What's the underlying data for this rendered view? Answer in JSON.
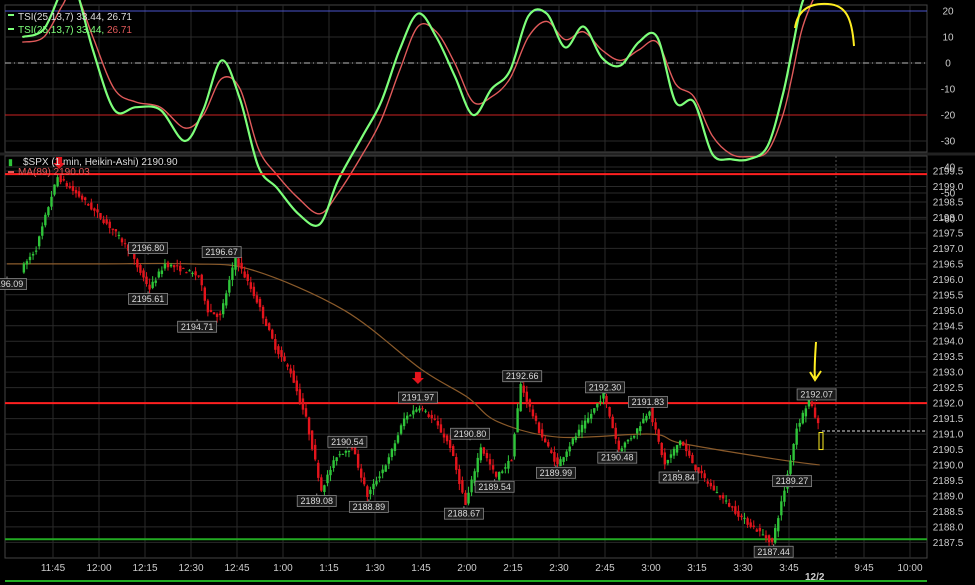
{
  "colors": {
    "up": "#2fc43a",
    "down": "#e3141c",
    "tsi": "#7dff7a",
    "signal": "#e05a5a",
    "ma": "#8a5a2a",
    "resistance": "#ff2020",
    "support": "#22aa22",
    "grid": "#2a2a2a",
    "annotation": "#ffee22"
  },
  "tsi_panel": {
    "legend_a": "TSI(25,13,7) 33.44, 26.71",
    "legend_b_prefix": "TSI(25,13,7) 33.44, ",
    "legend_b_suffix": "26.71",
    "y_ticks": [
      "30",
      "20",
      "10",
      "0",
      "-10",
      "-20",
      "-30",
      "-40",
      "-50",
      "-60"
    ]
  },
  "price_panel": {
    "legend_symbol": "$SPX (1 min, Heikin-Ashi) 2190.90",
    "legend_ma": "MA(89) 2190.03",
    "y_ticks": [
      "2199.5",
      "2199.0",
      "2198.5",
      "2198.0",
      "2197.5",
      "2197.0",
      "2196.5",
      "2196.0",
      "2195.5",
      "2195.0",
      "2194.5",
      "2194.0",
      "2193.5",
      "2193.0",
      "2192.5",
      "2192.0",
      "2191.5",
      "2191.0",
      "2190.5",
      "2190.0",
      "2189.5",
      "2189.0",
      "2188.5",
      "2188.0",
      "2187.5"
    ],
    "date_label": "12/2"
  },
  "chart_data": [
    {
      "type": "line",
      "title": "TSI(25,13,7) 33.44, 26.71",
      "ylim": [
        -65,
        38
      ],
      "reference_lines": [
        20,
        0,
        -20
      ],
      "series": [
        {
          "name": "TSI(25,13,7)",
          "x": [
            "11:35",
            "11:42",
            "11:48",
            "11:52",
            "11:58",
            "12:05",
            "12:12",
            "12:20",
            "12:28",
            "12:34",
            "12:40",
            "12:46",
            "12:52",
            "12:58",
            "13:05",
            "13:12",
            "13:18",
            "13:26",
            "13:32",
            "13:38",
            "13:44",
            "13:50",
            "13:56",
            "14:02",
            "14:08",
            "14:14",
            "14:20",
            "14:26",
            "14:32",
            "14:38",
            "14:44",
            "14:50",
            "14:56",
            "15:02",
            "15:08",
            "15:14",
            "15:20",
            "15:26",
            "15:32",
            "15:38",
            "15:43",
            "15:46",
            "15:49",
            "15:52",
            "15:54"
          ],
          "values": [
            10,
            13,
            28,
            30,
            5,
            -18,
            -17,
            -18,
            -30,
            -18,
            1,
            -14,
            -40,
            -48,
            -58,
            -62,
            -45,
            -28,
            -15,
            5,
            19,
            10,
            -5,
            -20,
            -10,
            -3,
            18,
            19,
            6,
            14,
            2,
            -1,
            8,
            10,
            -15,
            -15,
            -35,
            -37,
            -37,
            -32,
            -12,
            5,
            22,
            30,
            32
          ]
        },
        {
          "name": "signal",
          "x": [
            "11:35",
            "11:42",
            "11:48",
            "11:52",
            "11:58",
            "12:05",
            "12:12",
            "12:20",
            "12:28",
            "12:34",
            "12:40",
            "12:46",
            "12:52",
            "12:58",
            "13:05",
            "13:12",
            "13:18",
            "13:26",
            "13:32",
            "13:38",
            "13:44",
            "13:50",
            "13:56",
            "14:02",
            "14:08",
            "14:14",
            "14:20",
            "14:26",
            "14:32",
            "14:38",
            "14:44",
            "14:50",
            "14:56",
            "15:02",
            "15:08",
            "15:14",
            "15:20",
            "15:26",
            "15:32",
            "15:38",
            "15:43",
            "15:46",
            "15:49",
            "15:52",
            "15:54"
          ],
          "values": [
            8,
            10,
            22,
            28,
            10,
            -10,
            -15,
            -17,
            -25,
            -20,
            -6,
            -10,
            -33,
            -43,
            -52,
            -58,
            -50,
            -35,
            -22,
            -3,
            14,
            12,
            0,
            -15,
            -13,
            -6,
            10,
            16,
            9,
            12,
            5,
            1,
            5,
            8,
            -8,
            -13,
            -28,
            -35,
            -36,
            -34,
            -20,
            -5,
            12,
            22,
            27
          ]
        }
      ]
    },
    {
      "type": "candlestick",
      "title": "$SPX (1 min, Heikin-Ashi) 2190.90",
      "ylim": [
        2187.25,
        2199.75
      ],
      "x_ticks": [
        "11:45",
        "12:00",
        "12:15",
        "12:30",
        "12:45",
        "1:00",
        "1:15",
        "1:30",
        "1:45",
        "2:00",
        "2:15",
        "2:30",
        "2:45",
        "3:00",
        "3:15",
        "3:30",
        "3:45",
        "9:45",
        "10:00"
      ],
      "path": [
        [
          "11:35",
          2196.3
        ],
        [
          "11:40",
          2197.0
        ],
        [
          "11:45",
          2198.7
        ],
        [
          "11:47",
          2199.3
        ],
        [
          "11:55",
          2198.6
        ],
        [
          "12:05",
          2197.6
        ],
        [
          "12:10",
          2197.0
        ],
        [
          "12:13",
          2196.4
        ],
        [
          "12:17",
          2195.7
        ],
        [
          "12:22",
          2196.5
        ],
        [
          "12:28",
          2196.3
        ],
        [
          "12:33",
          2196.1
        ],
        [
          "12:36",
          2195.0
        ],
        [
          "12:40",
          2194.8
        ],
        [
          "12:45",
          2196.7
        ],
        [
          "12:52",
          2195.3
        ],
        [
          "12:58",
          2193.8
        ],
        [
          "13:03",
          2193.0
        ],
        [
          "13:08",
          2191.5
        ],
        [
          "13:13",
          2189.2
        ],
        [
          "13:18",
          2190.3
        ],
        [
          "13:23",
          2190.6
        ],
        [
          "13:28",
          2189.0
        ],
        [
          "13:35",
          2190.2
        ],
        [
          "13:40",
          2191.5
        ],
        [
          "13:45",
          2191.9
        ],
        [
          "13:50",
          2191.4
        ],
        [
          "13:55",
          2190.6
        ],
        [
          "14:00",
          2188.7
        ],
        [
          "14:05",
          2190.6
        ],
        [
          "14:10",
          2189.6
        ],
        [
          "14:15",
          2190.2
        ],
        [
          "14:18",
          2192.6
        ],
        [
          "14:24",
          2191.1
        ],
        [
          "14:30",
          2190.0
        ],
        [
          "14:35",
          2190.8
        ],
        [
          "14:40",
          2191.5
        ],
        [
          "14:45",
          2192.3
        ],
        [
          "14:50",
          2190.5
        ],
        [
          "14:55",
          2191.0
        ],
        [
          "15:00",
          2191.8
        ],
        [
          "15:05",
          2190.0
        ],
        [
          "15:10",
          2190.8
        ],
        [
          "15:15",
          2189.9
        ],
        [
          "15:20",
          2189.3
        ],
        [
          "15:25",
          2188.8
        ],
        [
          "15:30",
          2188.3
        ],
        [
          "15:35",
          2187.9
        ],
        [
          "15:40",
          2187.5
        ],
        [
          "15:44",
          2189.2
        ],
        [
          "15:48",
          2191.2
        ],
        [
          "15:52",
          2192.1
        ],
        [
          "15:55",
          2191.3
        ]
      ],
      "ma89": [
        [
          "11:30",
          2196.5
        ],
        [
          "12:00",
          2196.5
        ],
        [
          "12:30",
          2196.5
        ],
        [
          "12:50",
          2196.3
        ],
        [
          "13:20",
          2195.0
        ],
        [
          "13:45",
          2193.1
        ],
        [
          "14:00",
          2192.2
        ],
        [
          "14:10",
          2191.4
        ],
        [
          "14:30",
          2190.9
        ],
        [
          "15:00",
          2191.0
        ],
        [
          "15:10",
          2190.7
        ],
        [
          "15:40",
          2190.2
        ],
        [
          "15:55",
          2190.0
        ]
      ],
      "horizontal_lines": [
        {
          "kind": "resistance",
          "value": 2199.4
        },
        {
          "kind": "resistance",
          "value": 2192.0
        },
        {
          "kind": "support",
          "value": 2187.6
        },
        {
          "kind": "current",
          "value": 2191.1
        }
      ],
      "annotations": [
        {
          "label": "2196.09",
          "x": "11:30",
          "y": 2196.09,
          "pos": "below"
        },
        {
          "label": "2196.80",
          "x": "12:16",
          "y": 2196.8,
          "pos": "above"
        },
        {
          "label": "2195.61",
          "x": "12:16",
          "y": 2195.61,
          "pos": "below"
        },
        {
          "label": "2196.67",
          "x": "12:40",
          "y": 2196.67,
          "pos": "above"
        },
        {
          "label": "2194.71",
          "x": "12:32",
          "y": 2194.71,
          "pos": "below"
        },
        {
          "label": "2190.54",
          "x": "13:21",
          "y": 2190.54,
          "pos": "above"
        },
        {
          "label": "2189.08",
          "x": "13:11",
          "y": 2189.08,
          "pos": "below"
        },
        {
          "label": "2188.89",
          "x": "13:28",
          "y": 2188.89,
          "pos": "below"
        },
        {
          "label": "2191.97",
          "x": "13:44",
          "y": 2191.97,
          "pos": "above"
        },
        {
          "label": "2190.80",
          "x": "14:01",
          "y": 2190.8,
          "pos": "above"
        },
        {
          "label": "2188.67",
          "x": "13:59",
          "y": 2188.67,
          "pos": "below"
        },
        {
          "label": "2189.54",
          "x": "14:09",
          "y": 2189.54,
          "pos": "below"
        },
        {
          "label": "2192.66",
          "x": "14:18",
          "y": 2192.66,
          "pos": "above"
        },
        {
          "label": "2189.99",
          "x": "14:29",
          "y": 2189.99,
          "pos": "below"
        },
        {
          "label": "2192.30",
          "x": "14:45",
          "y": 2192.3,
          "pos": "above"
        },
        {
          "label": "2190.48",
          "x": "14:49",
          "y": 2190.48,
          "pos": "below"
        },
        {
          "label": "2191.83",
          "x": "14:59",
          "y": 2191.83,
          "pos": "above"
        },
        {
          "label": "2189.84",
          "x": "15:09",
          "y": 2189.84,
          "pos": "below"
        },
        {
          "label": "2189.27",
          "x": "15:46",
          "y": 2189.27,
          "pos": "above"
        },
        {
          "label": "2187.44",
          "x": "15:40",
          "y": 2187.44,
          "pos": "below"
        },
        {
          "label": "2192.07",
          "x": "15:54",
          "y": 2192.07,
          "pos": "above"
        }
      ]
    }
  ]
}
